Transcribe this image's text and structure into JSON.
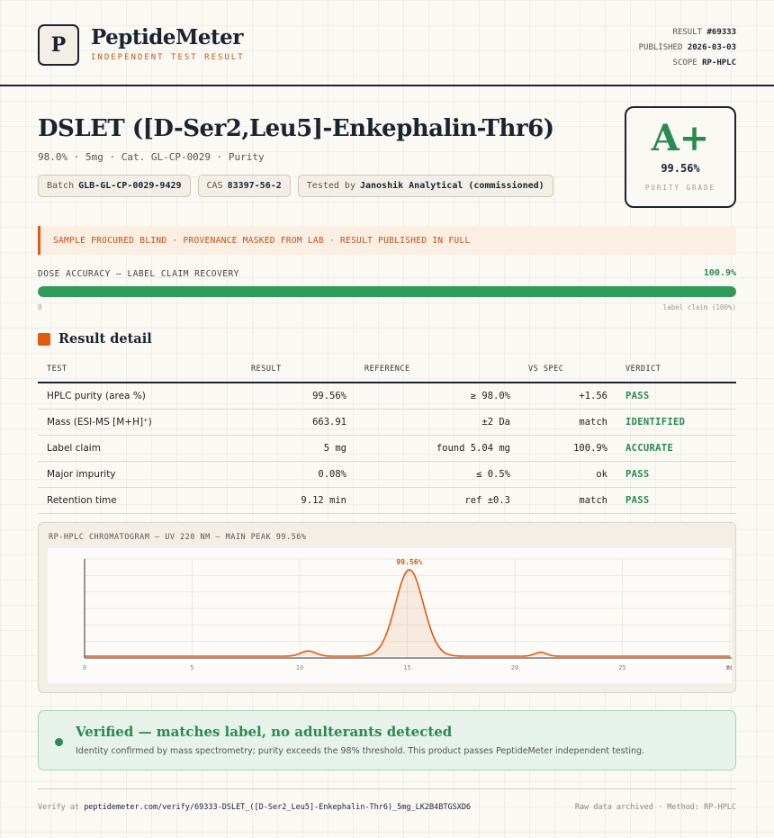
{
  "header": {
    "logo_letter": "P",
    "brand": "PeptideMeter",
    "brand_sub": "INDEPENDENT TEST RESULT",
    "result_label": "RESULT",
    "result_value": "#69333",
    "published_label": "PUBLISHED",
    "published_value": "2026-03-03",
    "scope_label": "SCOPE",
    "scope_value": "RP-HPLC"
  },
  "product": {
    "title": "DSLET ([D-Ser2,Leu5]-Enkephalin-Thr6)",
    "subtitle": "98.0% · 5mg · Cat. GL-CP-0029 · Purity",
    "batch_label": "Batch",
    "batch_value": "GLB-GL-CP-0029-9429",
    "cas_label": "CAS",
    "cas_value": "83397-56-2",
    "tested_label": "Tested by",
    "tested_value": "Janoshik Analytical (commissioned)"
  },
  "grade": {
    "letter": "A+",
    "value": "99.56%",
    "label": "PURITY GRADE"
  },
  "banner": "SAMPLE PROCURED BLIND · PROVENANCE MASKED FROM LAB · RESULT PUBLISHED IN FULL",
  "dose": {
    "label": "DOSE ACCURACY — LABEL CLAIM RECOVERY",
    "value": "100.9%",
    "fill_percent": 100,
    "min_label": "0",
    "claim_label": "label claim (100%)"
  },
  "results": {
    "section_title": "Result detail",
    "headers": [
      "TEST",
      "RESULT",
      "REFERENCE",
      "VS SPEC",
      "VERDICT"
    ],
    "rows": [
      {
        "test": "HPLC purity (area %)",
        "result": "99.56%",
        "reference": "≥ 98.0%",
        "vs": "+1.56",
        "verdict": "PASS"
      },
      {
        "test": "Mass (ESI-MS [M+H]⁺)",
        "result": "663.91",
        "reference": "±2 Da",
        "vs": "match",
        "verdict": "IDENTIFIED"
      },
      {
        "test": "Label claim",
        "result": "5 mg",
        "reference": "found 5.04 mg",
        "vs": "100.9%",
        "verdict": "ACCURATE"
      },
      {
        "test": "Major impurity",
        "result": "0.08%",
        "reference": "≤ 0.5%",
        "vs": "ok",
        "verdict": "PASS"
      },
      {
        "test": "Retention time",
        "result": "9.12 min",
        "reference": "ref ±0.3",
        "vs": "match",
        "verdict": "PASS"
      }
    ]
  },
  "chromatogram": {
    "title": "RP-HPLC CHROMATOGRAM — UV 220 NM — MAIN PEAK 99.56%",
    "peak_label": "99.56%",
    "x_ticks": [
      "0",
      "5",
      "10",
      "15",
      "20",
      "25",
      "30"
    ],
    "x_unit": "min",
    "xlim": [
      0,
      30
    ],
    "peaks": [
      {
        "center": 10.4,
        "height": 0.06,
        "width": 0.35
      },
      {
        "center": 15.1,
        "height": 1.0,
        "width": 0.65
      },
      {
        "center": 21.2,
        "height": 0.045,
        "width": 0.28
      }
    ],
    "line_color": "#e05a12"
  },
  "verified": {
    "title": "Verified — matches label, no adulterants detected",
    "text": "Identity confirmed by mass spectrometry; purity exceeds the 98% threshold. This product passes PeptideMeter independent testing."
  },
  "footer": {
    "verify_label": "Verify at",
    "verify_url": "peptidemeter.com/verify/69333-DSLET_([D-Ser2_Leu5]-Enkephalin-Thr6)_5mg_LK2B4BTGSXD6",
    "right": "Raw data archived · Method: RP-HPLC"
  },
  "colors": {
    "accent": "#e05a12",
    "success": "#2a8a4f",
    "ink": "#1c2230"
  }
}
